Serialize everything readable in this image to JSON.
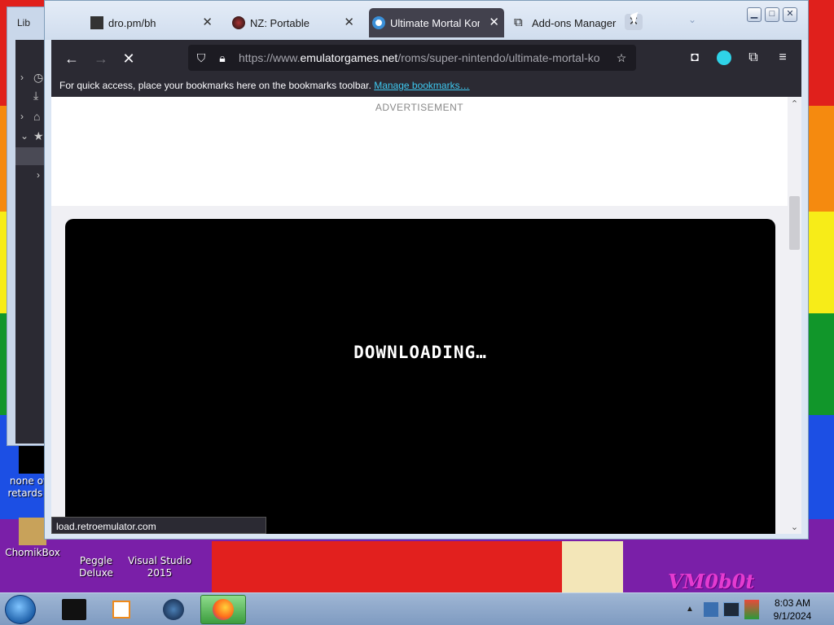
{
  "desktop": {
    "icons": [
      {
        "label": "none of y retards kn"
      },
      {
        "label": "ChomikBox"
      },
      {
        "label": "Peggle Deluxe"
      },
      {
        "label": "Visual Studio 2015"
      }
    ],
    "signature": "VM0b0t"
  },
  "back_window": {
    "tab_label": "Lib"
  },
  "browser": {
    "tabs": [
      {
        "label": "dro.pm/bh",
        "close": "✕"
      },
      {
        "label": "NZ: Portable",
        "close": "✕"
      },
      {
        "label": "Ultimate Mortal Kombat",
        "close": "✕"
      },
      {
        "label": "Add-ons Manager",
        "close": "✕"
      }
    ],
    "url_prefix": "https://www.",
    "url_domain": "emulatorgames.net",
    "url_path": "/roms/super-nintendo/ultimate-mortal-ko",
    "bookmarks_hint": "For quick access, place your bookmarks here on the bookmarks toolbar.",
    "bookmarks_link": "Manage bookmarks…",
    "ad_label": "ADVERTISEMENT",
    "game_status": "DOWNLOADING…",
    "status_url": "load.retroemulator.com"
  },
  "taskbar": {
    "time": "8:03 AM",
    "date": "9/1/2024"
  },
  "colors": {
    "chrome_bg": "#2b2a33",
    "link": "#3ec8f0",
    "taskbar": "#9fb6d4"
  }
}
